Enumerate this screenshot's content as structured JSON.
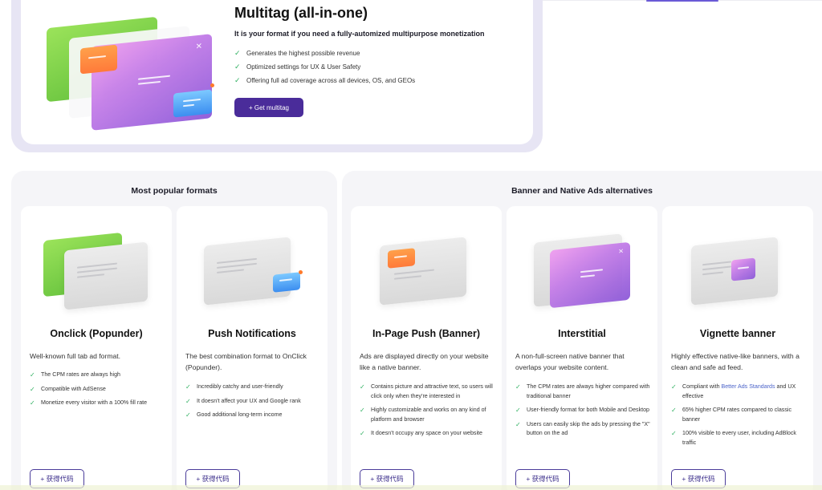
{
  "multitag": {
    "title": "Multitag (all-in-one)",
    "subtitle": "It is your format if you need a fully-automized multipurpose monetization",
    "features": [
      "Generates the highest possible revenue",
      "Optimized settings for UX & User Safety",
      "Offering full ad coverage across all devices, OS, and GEOs"
    ],
    "button_label": "+ Get multitag"
  },
  "panels": {
    "popular_title": "Most popular formats",
    "banner_title": "Banner and Native Ads alternatives"
  },
  "cards": [
    {
      "title": "Onclick (Popunder)",
      "description": "Well-known full tab ad format.",
      "features": [
        "The CPM rates are always high",
        "Compatible with AdSense",
        "Monetize every visitor with a 100% fill rate"
      ],
      "button_label": "+ 获得代码"
    },
    {
      "title": "Push Notifications",
      "description": "The best combination format to OnClick (Popunder).",
      "features": [
        "Incredibly catchy and user-friendly",
        "It doesn't affect your UX and Google rank",
        "Good additional long-term income"
      ],
      "button_label": "+ 获得代码"
    },
    {
      "title": "In-Page Push (Banner)",
      "description": "Ads are displayed directly on your website like a native banner.",
      "features": [
        "Contains picture and attractive text, so users will click only when they're interested in",
        "Highly customizable and works on any kind of platform and browser",
        "It doesn't occupy any space on your website"
      ],
      "button_label": "+ 获得代码"
    },
    {
      "title": "Interstitial",
      "description": "A non-full-screen native banner that overlaps your website content.",
      "features": [
        "The CPM rates are always higher compared with traditional banner",
        "User-friendly format for both Mobile and Desktop",
        "Users can easily skip the ads by pressing the \"X\" button on the ad"
      ],
      "button_label": "+ 获得代码"
    },
    {
      "title": "Vignette banner",
      "description": "Highly effective native-like banners, with a clean and safe ad feed.",
      "features_v": {
        "f1_prefix": "Compliant with ",
        "f1_link": "Better Ads Standards",
        "f1_suffix": " and UX effective",
        "f2": "65% higher CPM rates compared to classic banner",
        "f3": "100% visible to every user, including AdBlock traffic"
      },
      "button_label": "+ 获得代码"
    }
  ],
  "icons": {
    "check": "✓",
    "close": "✕"
  },
  "colors": {
    "accent": "#4a2c9a",
    "check": "#2fb061",
    "panel": "#f5f5f8",
    "link": "#4b63c9"
  }
}
